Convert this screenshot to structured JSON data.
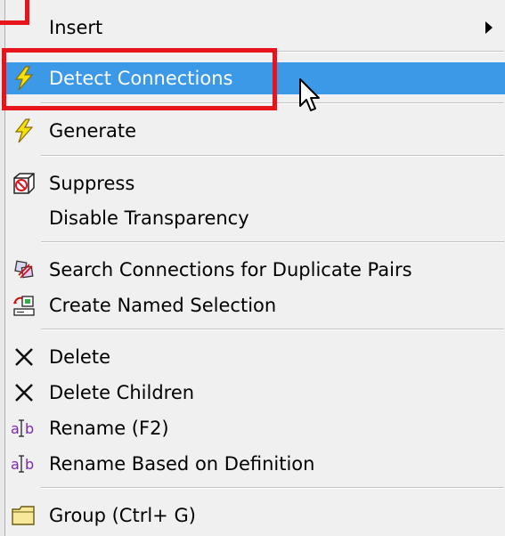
{
  "menu": {
    "items": [
      {
        "label": "Insert",
        "icon": "",
        "has_submenu": true
      },
      {
        "label": "Detect Connections",
        "icon": "lightning-icon",
        "highlighted": true
      },
      {
        "label": "Generate",
        "icon": "lightning-icon"
      },
      {
        "label": "Suppress",
        "icon": "suppress-icon"
      },
      {
        "label": "Disable Transparency",
        "icon": ""
      },
      {
        "label": "Search Connections for Duplicate Pairs",
        "icon": "search-duplicate-icon"
      },
      {
        "label": "Create Named Selection",
        "icon": "named-selection-icon"
      },
      {
        "label": "Delete",
        "icon": "delete-x-icon"
      },
      {
        "label": "Delete Children",
        "icon": "delete-x-icon"
      },
      {
        "label": "Rename (F2)",
        "icon": "rename-icon"
      },
      {
        "label": "Rename Based on Definition",
        "icon": "rename-icon"
      },
      {
        "label": "Group (Ctrl+ G)",
        "icon": "folder-icon"
      }
    ]
  },
  "colors": {
    "highlight": "#3b99e8",
    "annotation": "#e8141c",
    "menu_bg": "#f0f0f0"
  }
}
